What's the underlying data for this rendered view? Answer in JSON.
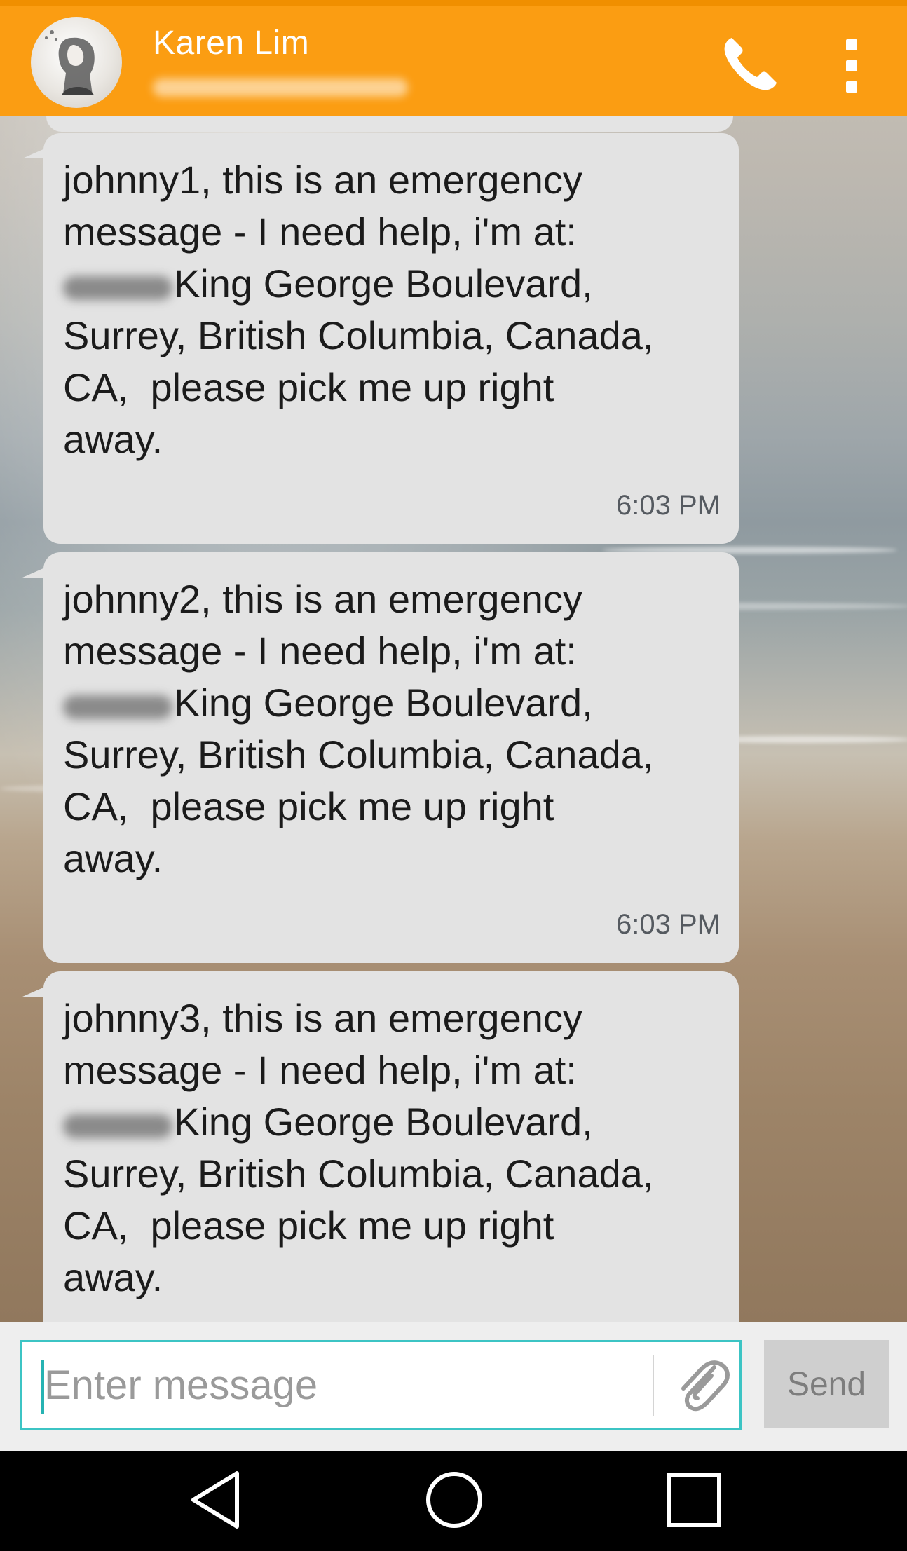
{
  "header": {
    "contact_name": "Karen Lim",
    "avatar_icon": "user-avatar",
    "call_icon": "phone-icon",
    "menu_icon": "overflow-menu-icon",
    "background_color": "#fb9d12"
  },
  "messages": [
    {
      "line1": "johnny1, this is an emergency",
      "line2": "message - I need help, i'm at:",
      "line3": "King George Boulevard,",
      "line4": "Surrey, British Columbia, Canada,",
      "line5": "CA,  please pick me up right",
      "line6": "away.",
      "time": "6:03 PM"
    },
    {
      "line1": "johnny2, this is an emergency",
      "line2": "message - I need help, i'm at:",
      "line3": "King George Boulevard,",
      "line4": "Surrey, British Columbia, Canada,",
      "line5": "CA,  please pick me up right",
      "line6": "away.",
      "time": "6:03 PM"
    },
    {
      "line1": "johnny3, this is an emergency",
      "line2": "message - I need help, i'm at:",
      "line3": "King George Boulevard,",
      "line4": "Surrey, British Columbia, Canada,",
      "line5": "CA,  please pick me up right",
      "line6": "away."
    }
  ],
  "composer": {
    "placeholder": "Enter message",
    "attach_icon": "paperclip-icon",
    "send_label": "Send",
    "accent_color": "#3cc4c4"
  },
  "navbar": {
    "back_icon": "back-triangle-icon",
    "home_icon": "home-circle-icon",
    "recents_icon": "recents-square-icon"
  }
}
